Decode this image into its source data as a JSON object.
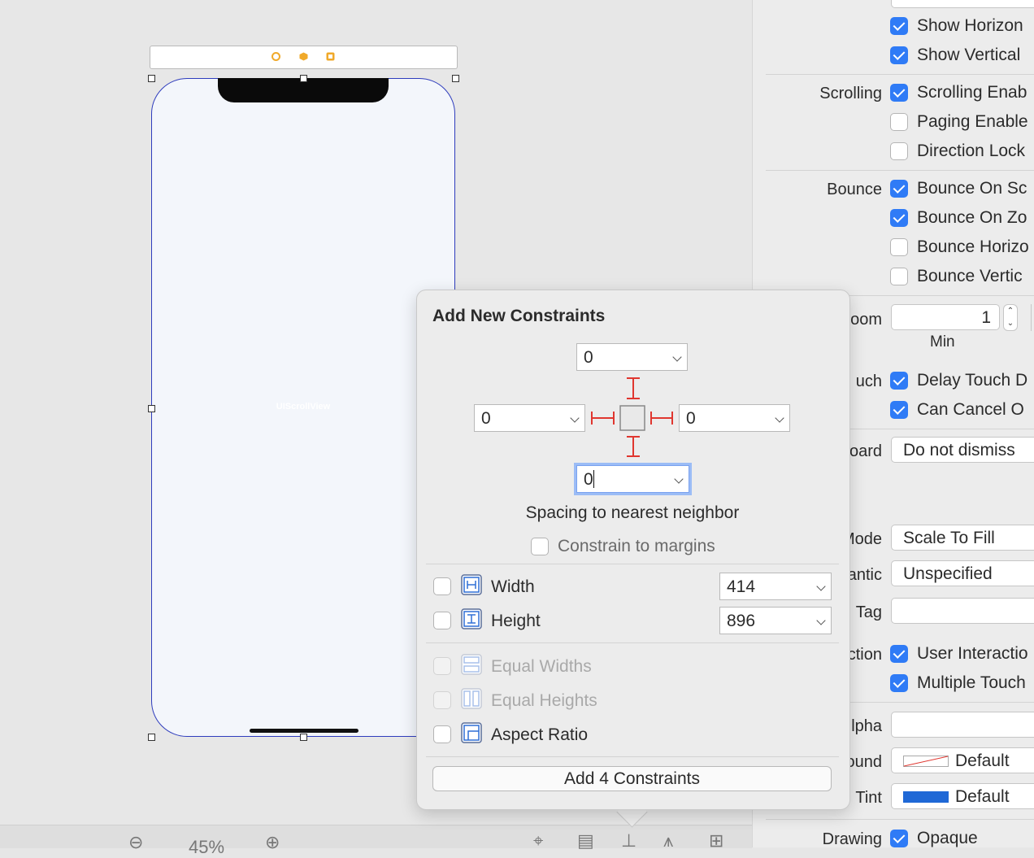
{
  "canvas": {
    "view_label": "UIScrollView",
    "zoom_level": "45%"
  },
  "popover": {
    "title": "Add New Constraints",
    "top_value": "0",
    "left_value": "0",
    "right_value": "0",
    "bottom_value": "0",
    "spacing_caption": "Spacing to nearest neighbor",
    "constrain_margins_label": "Constrain to margins",
    "width_label": "Width",
    "width_value": "414",
    "height_label": "Height",
    "height_value": "896",
    "equal_widths_label": "Equal Widths",
    "equal_heights_label": "Equal Heights",
    "aspect_ratio_label": "Aspect Ratio",
    "add_button_label": "Add 4 Constraints"
  },
  "inspector": {
    "show_horizontal": "Show Horizon",
    "show_vertical": "Show Vertical",
    "scrolling_label": "Scrolling",
    "scrolling_enabled": "Scrolling Enab",
    "paging_enabled": "Paging Enable",
    "direction_lock": "Direction Lock",
    "bounce_label": "Bounce",
    "bounce_scroll": "Bounce On Sc",
    "bounce_zoom": "Bounce On Zo",
    "bounce_horizontal": "Bounce Horizo",
    "bounce_vertical": "Bounce Vertic",
    "zoom_label": "oom",
    "zoom_value": "1",
    "zoom_min_label": "Min",
    "touch_label": "uch",
    "delay_touch": "Delay Touch D",
    "can_cancel": "Can Cancel O",
    "keyboard_label": "oard",
    "keyboard_value": "Do not dismiss",
    "mode_label": "Mode",
    "mode_value": "Scale To Fill",
    "semantic_label": "antic",
    "semantic_value": "Unspecified",
    "tag_label": "Tag",
    "interaction_label": "ction",
    "user_interaction": "User Interactio",
    "multiple_touch": "Multiple Touch",
    "alpha_label": "lpha",
    "background_label": "ound",
    "background_value": "Default",
    "tint_label": "Tint",
    "tint_value": "Default",
    "drawing_label": "Drawing",
    "opaque": "Opaque"
  },
  "colors": {
    "constraint_red": "#e0362f",
    "checkbox_blue": "#2f7bf6",
    "tint_swatch": "#1f68d6",
    "selection_blue": "#2f3dbd"
  }
}
